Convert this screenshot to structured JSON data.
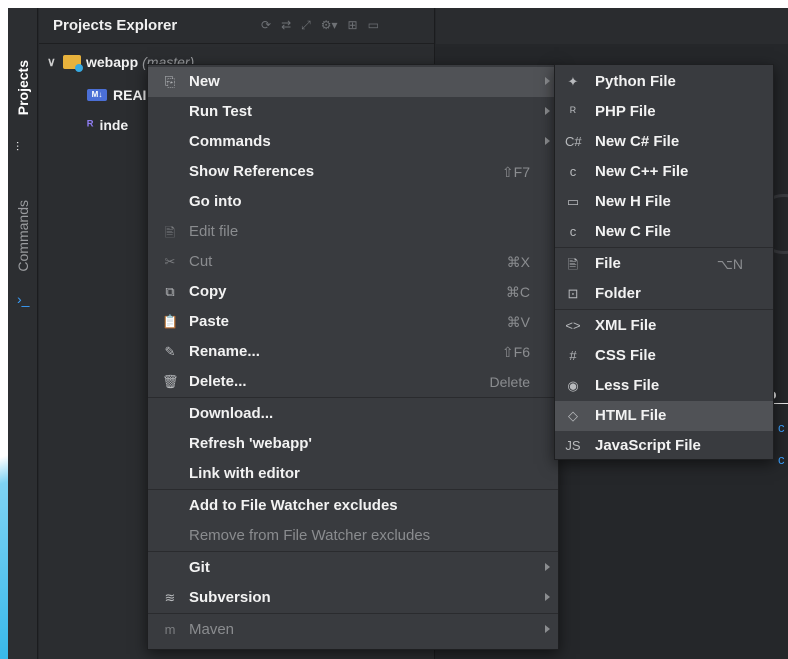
{
  "explorer": {
    "title": "Projects Explorer",
    "tools": [
      "⟳",
      "⇄",
      "⤢",
      "⚙▾",
      "⊞",
      "▭"
    ]
  },
  "side_tabs": {
    "projects": "Projects",
    "commands": "Commands"
  },
  "tree": {
    "root_name": "webapp",
    "root_branch": "(master)",
    "readme_label": "REAI",
    "readme_badge": "M↓",
    "index_label": "inde"
  },
  "editor_fragments": {
    "frag1": "o",
    "frag2": "c",
    "frag3": "c"
  },
  "context_menu": {
    "items": [
      {
        "label": "New",
        "icon": "⎘",
        "shortcut": "",
        "submenu": true,
        "disabled": false,
        "highlight": true
      },
      {
        "label": "Run Test",
        "icon": "",
        "shortcut": "",
        "submenu": true,
        "disabled": false,
        "highlight": false
      },
      {
        "label": "Commands",
        "icon": "",
        "shortcut": "",
        "submenu": true,
        "disabled": false,
        "highlight": false
      },
      {
        "label": "Show References",
        "icon": "",
        "shortcut": "⇧F7",
        "submenu": false,
        "disabled": false,
        "highlight": false
      },
      {
        "label": "Go into",
        "icon": "",
        "shortcut": "",
        "submenu": false,
        "disabled": false,
        "highlight": false
      },
      {
        "label": "Edit file",
        "icon": "🖹",
        "shortcut": "",
        "submenu": false,
        "disabled": true,
        "highlight": false
      },
      {
        "label": "Cut",
        "icon": "✂",
        "shortcut": "⌘X",
        "submenu": false,
        "disabled": true,
        "highlight": false
      },
      {
        "label": "Copy",
        "icon": "⧉",
        "shortcut": "⌘C",
        "submenu": false,
        "disabled": false,
        "highlight": false
      },
      {
        "label": "Paste",
        "icon": "📋",
        "shortcut": "⌘V",
        "submenu": false,
        "disabled": false,
        "highlight": false
      },
      {
        "label": "Rename...",
        "icon": "✎",
        "shortcut": "⇧F6",
        "submenu": false,
        "disabled": false,
        "highlight": false
      },
      {
        "label": "Delete...",
        "icon": "🗑",
        "shortcut": "Delete",
        "submenu": false,
        "disabled": false,
        "highlight": false
      },
      {
        "label": "Download...",
        "icon": "",
        "shortcut": "",
        "submenu": false,
        "disabled": false,
        "highlight": false
      },
      {
        "label": "Refresh 'webapp'",
        "icon": "",
        "shortcut": "",
        "submenu": false,
        "disabled": false,
        "highlight": false
      },
      {
        "label": "Link with editor",
        "icon": "",
        "shortcut": "",
        "submenu": false,
        "disabled": false,
        "highlight": false
      },
      {
        "label": "Add to File Watcher excludes",
        "icon": "",
        "shortcut": "",
        "submenu": false,
        "disabled": false,
        "highlight": false
      },
      {
        "label": "Remove from File Watcher excludes",
        "icon": "",
        "shortcut": "",
        "submenu": false,
        "disabled": true,
        "highlight": false
      },
      {
        "label": "Git",
        "icon": "",
        "shortcut": "",
        "submenu": true,
        "disabled": false,
        "highlight": false
      },
      {
        "label": "Subversion",
        "icon": "≋",
        "shortcut": "",
        "submenu": true,
        "disabled": false,
        "highlight": false
      },
      {
        "label": "Maven",
        "icon": "m",
        "shortcut": "",
        "submenu": true,
        "disabled": true,
        "highlight": false
      }
    ]
  },
  "new_submenu": {
    "items": [
      {
        "label": "Python File",
        "icon": "✦",
        "shortcut": "",
        "highlight": false
      },
      {
        "label": "PHP File",
        "icon": "ᴿ",
        "shortcut": "",
        "highlight": false
      },
      {
        "label": "New C# File",
        "icon": "C#",
        "shortcut": "",
        "highlight": false
      },
      {
        "label": "New C++ File",
        "icon": "c",
        "shortcut": "",
        "highlight": false
      },
      {
        "label": "New H File",
        "icon": "▭",
        "shortcut": "",
        "highlight": false
      },
      {
        "label": "New C File",
        "icon": "c",
        "shortcut": "",
        "highlight": false
      },
      {
        "label": "File",
        "icon": "🖹",
        "shortcut": "⌥N",
        "highlight": false
      },
      {
        "label": "Folder",
        "icon": "⊡",
        "shortcut": "",
        "highlight": false
      },
      {
        "label": "XML File",
        "icon": "<>",
        "shortcut": "",
        "highlight": false
      },
      {
        "label": "CSS File",
        "icon": "#",
        "shortcut": "",
        "highlight": false
      },
      {
        "label": "Less File",
        "icon": "◉",
        "shortcut": "",
        "highlight": false
      },
      {
        "label": "HTML File",
        "icon": "◇",
        "shortcut": "",
        "highlight": true
      },
      {
        "label": "JavaScript File",
        "icon": "JS",
        "shortcut": "",
        "highlight": false
      }
    ]
  },
  "colors": {
    "menu_bg": "#393b3f",
    "highlight_bg": "#505256",
    "ide_bg": "#25272a",
    "link_blue": "#3aa0ff",
    "folder_yellow": "#e8b23c"
  }
}
